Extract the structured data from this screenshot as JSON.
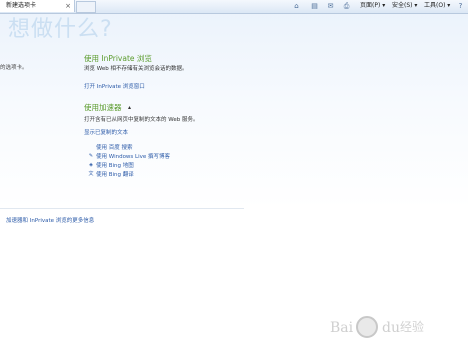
{
  "tabbar": {
    "tab_label": "新建选项卡",
    "tab_close": "×"
  },
  "toolbar": {
    "home_icon": "⌂",
    "feeds_icon": "▤",
    "mail_icon": "✉",
    "print_icon": "⎙",
    "page_label": "页面(P) ▾",
    "safety_label": "安全(S) ▾",
    "tools_label": "工具(O) ▾",
    "help_icon": "?"
  },
  "hero": {
    "headline": "想做什么?",
    "left_text": "的选项卡。"
  },
  "inprivate": {
    "title": "使用 InPrivate 浏览",
    "description": "浏览 Web 相不存储有关浏览会话的数据。",
    "link": "打开 InPrivate 浏览窗口"
  },
  "accelerators": {
    "title": "使用加速器",
    "chevron": "▴",
    "description": "打开含有已从网页中复制的文本的 Web 服务。",
    "show_copied": "显示已复制的文本",
    "items": [
      {
        "label": "使用 百度 搜索",
        "icon": "search-icon"
      },
      {
        "label": "使用 Windows Live 撰写博客",
        "icon": "blog-icon"
      },
      {
        "label": "使用 Bing 地图",
        "icon": "map-icon"
      },
      {
        "label": "使用 Bing 翻译",
        "icon": "translate-icon"
      }
    ]
  },
  "footer": {
    "link": "加速器和 InPrivate 浏览的更多信息"
  },
  "watermark": {
    "text1": "Bai",
    "text2": "du",
    "text3": "经验"
  }
}
